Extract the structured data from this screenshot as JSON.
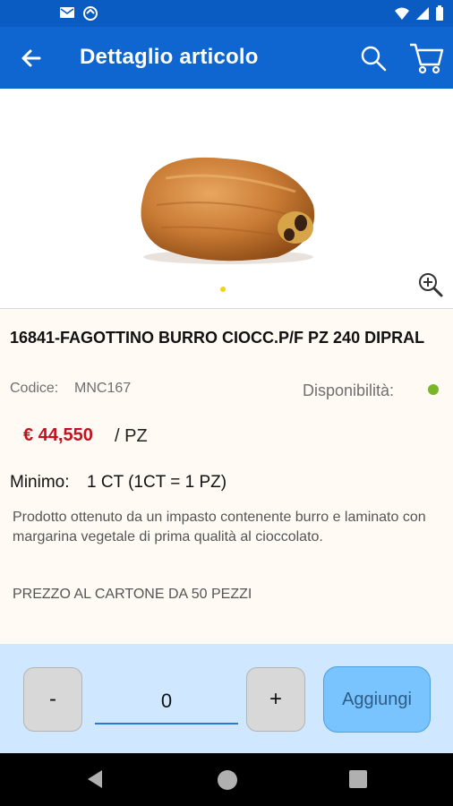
{
  "app": {
    "title": "Dettaglio articolo"
  },
  "status_bar": {
    "icons": [
      "mail-icon",
      "sync-icon",
      "wifi-icon",
      "signal-icon",
      "battery-icon"
    ]
  },
  "product": {
    "title": "16841-FAGOTTINO BURRO CIOCC.P/F PZ 240 DIPRAL",
    "code_label": "Codice:",
    "code_value": "MNC167",
    "availability_label": "Disponibilità:",
    "availability_status_color": "#7ab628",
    "price": "€ 44,550",
    "unit": "/ PZ",
    "minimum_label": "Minimo:",
    "minimum_value": "1 CT (1CT = 1 PZ)",
    "description": "Prodotto ottenuto da un impasto contenente burro e laminato con margarina vegetale di prima qualità al cioccolato.",
    "note": "PREZZO AL CARTONE DA 50 PEZZI"
  },
  "cart_controls": {
    "minus_label": "-",
    "quantity": "0",
    "plus_label": "+",
    "add_label": "Aggiungi"
  },
  "colors": {
    "primary": "#0f66d0",
    "price": "#c1121f",
    "add_button": "#79c3ff",
    "bottom_panel": "#cfe7ff"
  }
}
